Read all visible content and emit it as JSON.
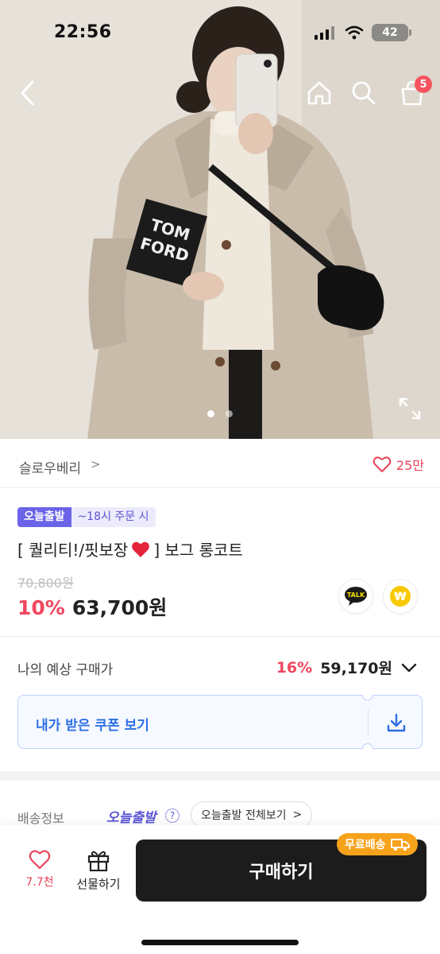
{
  "status": {
    "time": "22:56",
    "battery": "42"
  },
  "nav": {
    "cart_count": "5"
  },
  "gallery": {
    "pages": 2,
    "active_page": 1,
    "book_text": "TOM FORD"
  },
  "store": {
    "name": "슬로우베리",
    "chevron": ">",
    "likes": "25만"
  },
  "product": {
    "tag_main": "오늘출발",
    "tag_sub": "~18시 주문 시",
    "title_before": "[ 퀄리티!/핏보장",
    "title_heart": "❤️",
    "title_after": " ] 보그 롱코트",
    "original_price": "70,800원",
    "discount": "10%",
    "price": "63,700원",
    "talk_label": "TALK",
    "won_label": "₩"
  },
  "expected": {
    "label": "나의 예상 구매가",
    "discount": "16%",
    "price": "59,170원",
    "coupon_label": "내가 받은 쿠폰 보기"
  },
  "shipping": {
    "label": "배송정보",
    "brand": "오늘출발",
    "help": "?",
    "view_all": "오늘출발 전체보기",
    "view_all_chevron": ">"
  },
  "bottom": {
    "like_count": "7.7천",
    "gift_label": "선물하기",
    "buy_label": "구매하기",
    "free_shipping": "무료배송"
  },
  "colors": {
    "accent_red": "#f0475e",
    "today_purple": "#6b63e8",
    "coupon_blue": "#2d6fe5",
    "free_orange": "#f7a21b"
  }
}
